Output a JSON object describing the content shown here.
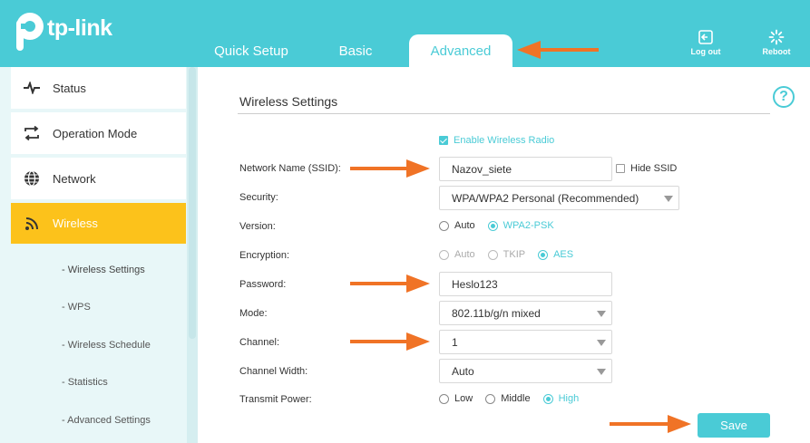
{
  "header": {
    "brand": "tp-link",
    "tabs": [
      "Quick Setup",
      "Basic",
      "Advanced"
    ],
    "logout_label": "Log out",
    "reboot_label": "Reboot"
  },
  "sidebar": {
    "items": [
      {
        "label": "Status",
        "icon": "pulse-icon"
      },
      {
        "label": "Operation Mode",
        "icon": "swap-icon"
      },
      {
        "label": "Network",
        "icon": "globe-icon"
      },
      {
        "label": "Wireless",
        "icon": "wifi-icon"
      }
    ],
    "subitems": [
      "- Wireless Settings",
      "- WPS",
      "- Wireless Schedule",
      "- Statistics",
      "- Advanced Settings"
    ]
  },
  "main": {
    "title": "Wireless Settings",
    "enable_radio_label": "Enable Wireless Radio",
    "ssid_label": "Network Name (SSID):",
    "ssid_value": "Nazov_siete",
    "hide_ssid_label": "Hide SSID",
    "security_label": "Security:",
    "security_value": "WPA/WPA2 Personal (Recommended)",
    "version_label": "Version:",
    "version_options": [
      "Auto",
      "WPA2-PSK"
    ],
    "encryption_label": "Encryption:",
    "encryption_options": [
      "Auto",
      "TKIP",
      "AES"
    ],
    "password_label": "Password:",
    "password_value": "Heslo123",
    "mode_label": "Mode:",
    "mode_value": "802.11b/g/n mixed",
    "channel_label": "Channel:",
    "channel_value": "1",
    "channel_width_label": "Channel Width:",
    "channel_width_value": "Auto",
    "transmit_power_label": "Transmit Power:",
    "transmit_power_options": [
      "Low",
      "Middle",
      "High"
    ],
    "save_label": "Save"
  },
  "colors": {
    "accent": "#4acbd6",
    "active_menu": "#fcc21b",
    "annotation_arrow": "#f07326"
  }
}
